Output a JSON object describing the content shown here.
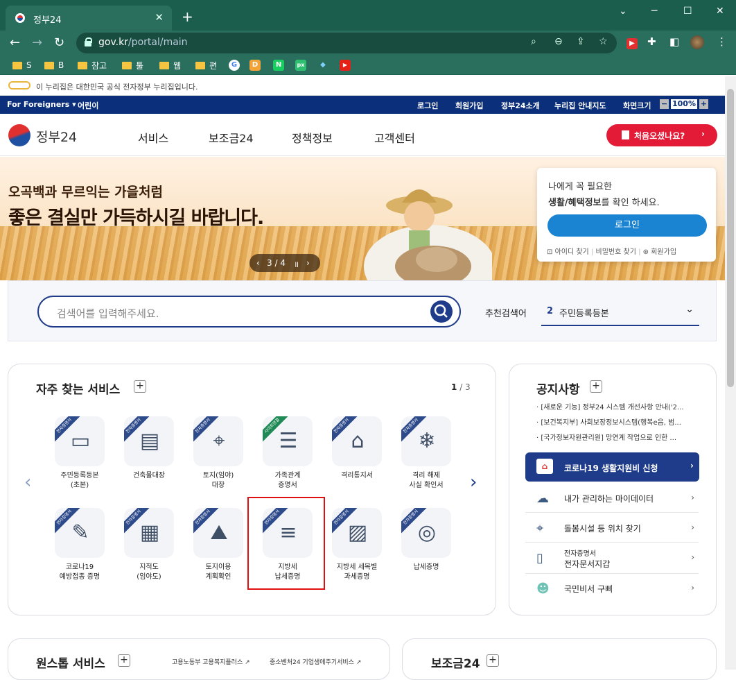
{
  "browser": {
    "tab_title": "정부24",
    "url_host": "gov.kr",
    "url_path": "/portal/main",
    "bookmarks": [
      "S",
      "B",
      "참고",
      "툴",
      "웹",
      "편"
    ],
    "bookmark_icons": [
      "G",
      "D",
      "N",
      "px",
      "◆",
      "▶"
    ]
  },
  "gov_notice": "이 누리집은 대한민국 공식 전자정부 누리집입니다.",
  "topnav": {
    "foreigners": "For Foreigners",
    "kids": "어린이",
    "login": "로그인",
    "signup": "회원가입",
    "about": "정부24소개",
    "sitemap": "누리집 안내지도",
    "zoom_label": "화면크기",
    "zoom_value": "100%"
  },
  "logo_text": "정부24",
  "menu": [
    "서비스",
    "보조금24",
    "정책정보",
    "고객센터"
  ],
  "first_visit": "처음오셨나요?",
  "banner": {
    "line1": "오곡백과 무르익는 가을처럼",
    "line2": "좋은 결실만 가득하시길 바랍니다.",
    "pager": "3 / 4"
  },
  "login_box": {
    "line1": "나에게 꼭 필요한",
    "line2_bold": "생활/혜택정보",
    "line2_rest": "를 확인 하세요.",
    "button": "로그인",
    "find_id": "아이디 찾기",
    "find_pw": "비밀번호 찾기",
    "signup": "회원가입"
  },
  "search": {
    "placeholder": "검색어를 입력해주세요.",
    "rec_label": "추천검색어",
    "rec_rank": "2",
    "rec_value": "주민등록등본"
  },
  "frequent": {
    "title": "자주 찾는 서비스",
    "page_current": "1",
    "page_total": "/ 3",
    "items": [
      {
        "badge": "전자증명서",
        "l1": "주민등록등본",
        "l2": "(초본)",
        "icon": "▭"
      },
      {
        "badge": "전자증명서",
        "l1": "건축물대장",
        "l2": "",
        "icon": "▤"
      },
      {
        "badge": "전자증명서",
        "l1": "토지(임야)",
        "l2": "대장",
        "icon": "⌖"
      },
      {
        "badge": "사이트연결",
        "l1": "가족관계",
        "l2": "증명서",
        "icon": "☰"
      },
      {
        "badge": "전자증명서",
        "l1": "격리통지서",
        "l2": "",
        "icon": "⌂"
      },
      {
        "badge": "전자증명서",
        "l1": "격리 해제",
        "l2": "사실 확인서",
        "icon": "❄"
      },
      {
        "badge": "전자증명서",
        "l1": "코로나19",
        "l2": "예방접종 증명",
        "icon": "✎"
      },
      {
        "badge": "전자증명서",
        "l1": "지적도",
        "l2": "(임야도)",
        "icon": "▦"
      },
      {
        "badge": "전자증명서",
        "l1": "토지이용",
        "l2": "계획확인",
        "icon": "⛰"
      },
      {
        "badge": "전자증명서",
        "l1": "지방세",
        "l2": "납세증명",
        "icon": "≡"
      },
      {
        "badge": "전자증명서",
        "l1": "지방세 세목별",
        "l2": "과세증명",
        "icon": "▨"
      },
      {
        "badge": "전자증명서",
        "l1": "납세증명",
        "l2": "",
        "icon": "◎"
      }
    ]
  },
  "notices": {
    "title": "공지사항",
    "items": [
      "[새로운 기능] 정부24 시스템 개선사항 안내('2...",
      "[보건복지부] 사회보장정보시스템(행복e음, 범...",
      "[국가정보자원관리원] 망연계 작업으로 인한 ..."
    ]
  },
  "quick": {
    "covid": "코로나19 생활지원비 신청",
    "mydata": "내가 관리하는 마이데이터",
    "care": "돌봄시설 등 위치 찾기",
    "wallet_small": "전자증명서",
    "wallet": "전자문서지갑",
    "gubbi": "국민비서 구삐"
  },
  "bottom": {
    "onestop": "원스톱 서비스",
    "link1": "고용노동부 고용복지플러스 ↗",
    "link2": "중소벤처24 기업생애주기서비스 ↗",
    "subsidy": "보조금24"
  }
}
